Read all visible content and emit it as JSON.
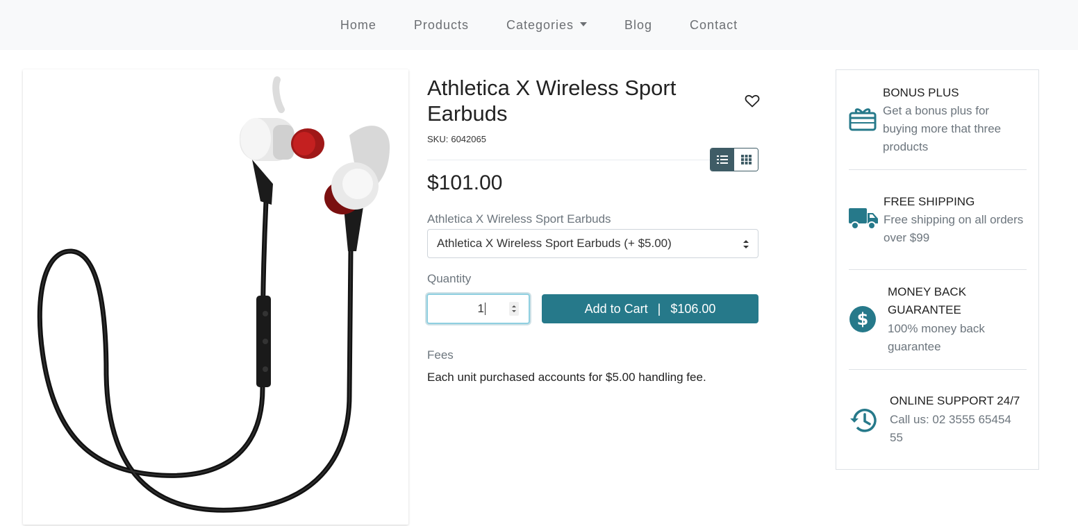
{
  "nav": {
    "items": [
      "Home",
      "Products",
      "Categories",
      "Blog",
      "Contact"
    ]
  },
  "product": {
    "title": "Athletica X Wireless Sport Earbuds",
    "sku_label": "SKU:",
    "sku": "6042065",
    "price": "$101.00",
    "variant_label": "Athletica X Wireless Sport Earbuds",
    "variant_selected": "Athletica X Wireless Sport Earbuds (+ $5.00)",
    "quantity_label": "Quantity",
    "quantity_value": "1",
    "add_to_cart_label": "Add to Cart",
    "add_to_cart_separator": "|",
    "add_to_cart_total": "$106.00",
    "fees_label": "Fees",
    "fees_text": "Each unit purchased accounts for $5.00 handling fee."
  },
  "sidebar": {
    "features": [
      {
        "icon": "gift-icon",
        "title": "BONUS PLUS",
        "desc": "Get a bonus plus for buying more that three products"
      },
      {
        "icon": "truck-icon",
        "title": "FREE SHIPPING",
        "desc": "Free shipping on all orders over $99"
      },
      {
        "icon": "dollar-circle-icon",
        "title": "MONEY BACK GUARANTEE",
        "desc": "100% money back guarantee"
      },
      {
        "icon": "history-icon",
        "title": "ONLINE SUPPORT 24/7",
        "desc": "Call us: 02 3555 65454 55"
      }
    ]
  },
  "colors": {
    "accent": "#26798a",
    "dark_accent": "#3f5c66",
    "navbar_bg": "#f8f9fa"
  }
}
